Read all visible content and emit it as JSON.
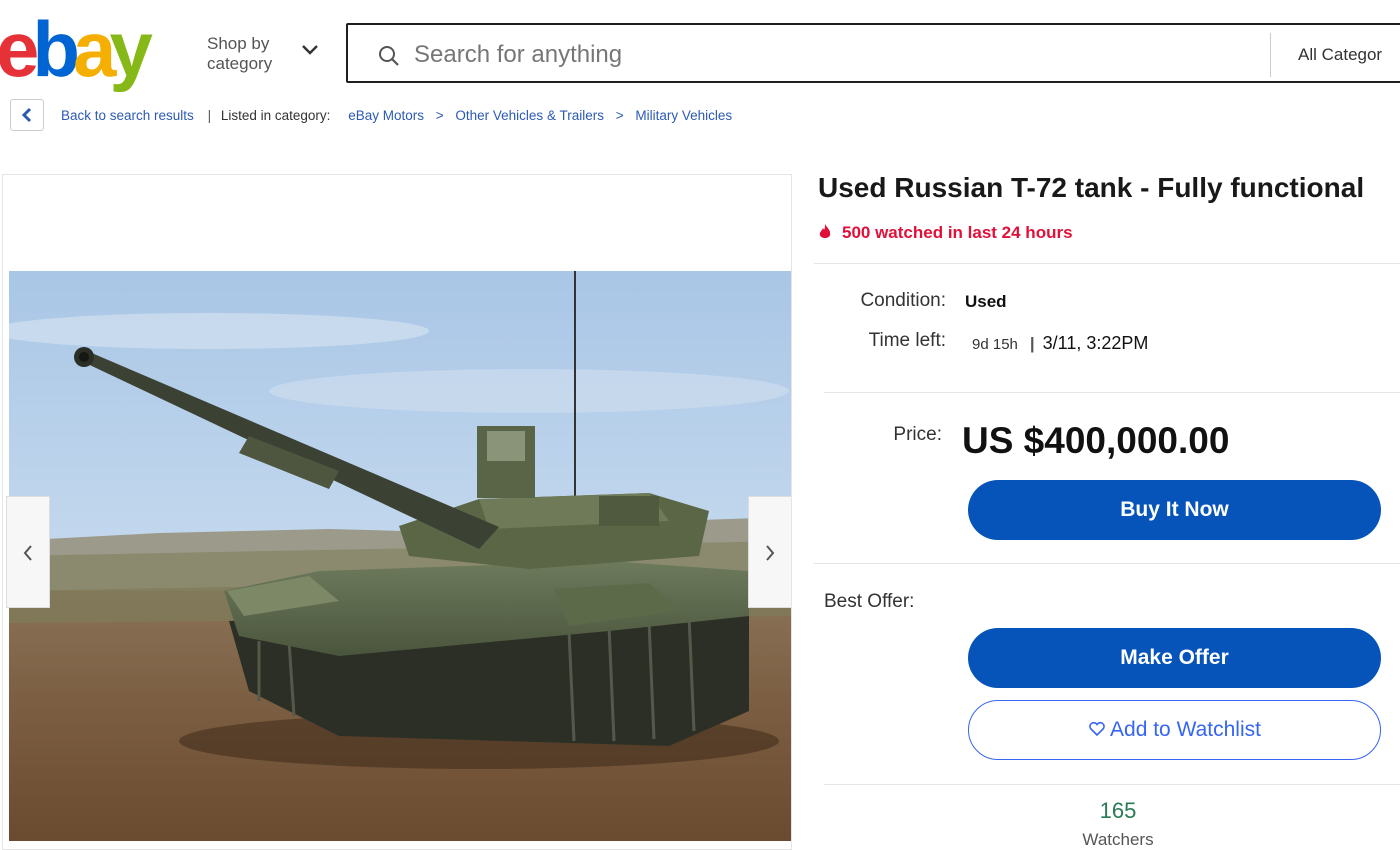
{
  "header": {
    "logo_text": "ebay",
    "shop_by_line1": "Shop by",
    "shop_by_line2": "category",
    "search_placeholder": "Search for anything",
    "category_select": "All Categor"
  },
  "breadcrumb": {
    "back_label": "Back to search results",
    "listed_in": "Listed in category:",
    "items": [
      "eBay Motors",
      "Other Vehicles & Trailers",
      "Military Vehicles"
    ]
  },
  "listing": {
    "title": "Used Russian T-72 tank - Fully functional",
    "hot_signal": "500 watched in last 24 hours",
    "condition_label": "Condition:",
    "condition_value": "Used",
    "time_left_label": "Time left:",
    "time_left_value": "9d 15h",
    "time_left_end": "3/11, 3:22PM",
    "price_label": "Price:",
    "price": "US $400,000.00",
    "buy_now": "Buy It Now",
    "best_offer_label": "Best Offer:",
    "make_offer": "Make Offer",
    "add_watchlist": "Add to Watchlist",
    "watchers_count": "165",
    "watchers_label": "Watchers"
  },
  "colors": {
    "ebay_red": "#e53238",
    "ebay_blue": "#0064d2",
    "ebay_yellow": "#f5af02",
    "ebay_green": "#86b817",
    "button_blue": "#0654ba",
    "hot_red": "#e0103a",
    "link_blue": "#2c5ab3"
  },
  "icons": {
    "search": "search-icon",
    "chevron": "chevron-down-icon",
    "back": "chevron-left-icon",
    "fire": "fire-icon",
    "heart": "heart-icon"
  }
}
